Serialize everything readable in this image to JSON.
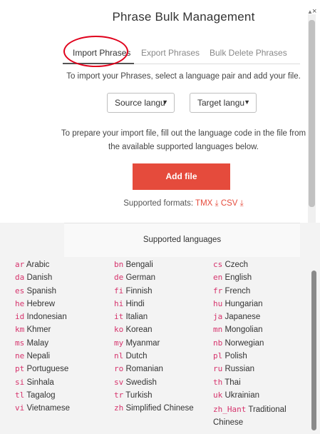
{
  "dialog": {
    "title": "Phrase Bulk Management",
    "close": "×"
  },
  "tabs": [
    {
      "label": "Import Phrases",
      "active": true
    },
    {
      "label": "Export Phrases",
      "active": false
    },
    {
      "label": "Bulk Delete Phrases",
      "active": false
    }
  ],
  "import": {
    "intro": "To import your Phrases, select a language pair and add your file.",
    "source_select": "Source langu",
    "target_select": "Target langu",
    "prep_line1": "To prepare your import file, fill out the language code in the file from",
    "prep_line2": "the available supported languages below.",
    "add_file_label": "Add file",
    "formats_label": "Supported formats:",
    "format_tmx": "TMX ⤓",
    "format_csv": "CSV ⤓"
  },
  "languages": {
    "header": "Supported languages",
    "col1": [
      {
        "code": "ar",
        "name": "Arabic"
      },
      {
        "code": "da",
        "name": "Danish"
      },
      {
        "code": "es",
        "name": "Spanish"
      },
      {
        "code": "he",
        "name": "Hebrew"
      },
      {
        "code": "id",
        "name": "Indonesian"
      },
      {
        "code": "km",
        "name": "Khmer"
      },
      {
        "code": "ms",
        "name": "Malay"
      },
      {
        "code": "ne",
        "name": "Nepali"
      },
      {
        "code": "pt",
        "name": "Portuguese"
      },
      {
        "code": "si",
        "name": "Sinhala"
      },
      {
        "code": "tl",
        "name": "Tagalog"
      },
      {
        "code": "vi",
        "name": "Vietnamese"
      }
    ],
    "col2": [
      {
        "code": "bn",
        "name": "Bengali"
      },
      {
        "code": "de",
        "name": "German"
      },
      {
        "code": "fi",
        "name": "Finnish"
      },
      {
        "code": "hi",
        "name": "Hindi"
      },
      {
        "code": "it",
        "name": "Italian"
      },
      {
        "code": "ko",
        "name": "Korean"
      },
      {
        "code": "my",
        "name": "Myanmar"
      },
      {
        "code": "nl",
        "name": "Dutch"
      },
      {
        "code": "ro",
        "name": "Romanian"
      },
      {
        "code": "sv",
        "name": "Swedish"
      },
      {
        "code": "tr",
        "name": "Turkish"
      },
      {
        "code": "zh",
        "name": "Simplified Chinese"
      }
    ],
    "col3": [
      {
        "code": "cs",
        "name": "Czech"
      },
      {
        "code": "en",
        "name": "English"
      },
      {
        "code": "fr",
        "name": "French"
      },
      {
        "code": "hu",
        "name": "Hungarian"
      },
      {
        "code": "ja",
        "name": "Japanese"
      },
      {
        "code": "mn",
        "name": "Mongolian"
      },
      {
        "code": "nb",
        "name": "Norwegian"
      },
      {
        "code": "pl",
        "name": "Polish"
      },
      {
        "code": "ru",
        "name": "Russian"
      },
      {
        "code": "th",
        "name": "Thai"
      },
      {
        "code": "uk",
        "name": "Ukrainian"
      },
      {
        "code": "zh_Hant",
        "name": "Traditional Chinese"
      }
    ]
  },
  "colors": {
    "accent": "#e54b3c",
    "code": "#d6336c",
    "annotation_circle": "#e0001b"
  }
}
